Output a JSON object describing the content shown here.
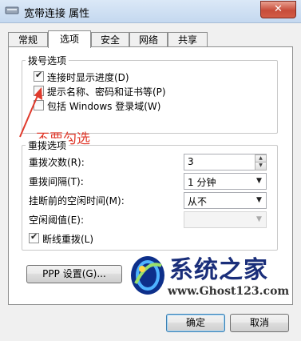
{
  "window": {
    "title": "宽带连接 属性",
    "close_symbol": "✕"
  },
  "tabs": [
    {
      "label": "常规",
      "active": false
    },
    {
      "label": "选项",
      "active": true
    },
    {
      "label": "安全",
      "active": false
    },
    {
      "label": "网络",
      "active": false
    },
    {
      "label": "共享",
      "active": false
    }
  ],
  "dial_options": {
    "title": "拨号选项",
    "items": [
      {
        "label": "连接时显示进度(D)",
        "checked": true
      },
      {
        "label": "提示名称、密码和证书等(P)",
        "checked": false
      },
      {
        "label": "包括 Windows 登录域(W)",
        "checked": false
      }
    ]
  },
  "annotation": {
    "text": "不要勾选",
    "color": "#e03a2c"
  },
  "redial_options": {
    "title": "重拨选项",
    "redial_count_label": "重拨次数(R):",
    "redial_count_value": "3",
    "redial_interval_label": "重拨间隔(T):",
    "redial_interval_value": "1 分钟",
    "idle_hangup_label": "挂断前的空闲时间(M):",
    "idle_hangup_value": "从不",
    "idle_threshold_label": "空闲阈值(E):",
    "idle_threshold_value": "",
    "reconnect_label": "断线重拨(L)",
    "reconnect_checked": true
  },
  "buttons": {
    "ppp_settings": "PPP 设置(G)...",
    "ok": "确定",
    "cancel": "取消"
  },
  "watermark": {
    "name": "系统之家",
    "url": "www.Ghost123.com"
  },
  "icons": {
    "title_icon": "network-connection-icon",
    "close": "close-icon",
    "check": "checkmark-icon",
    "spin_up": "spin-up-icon",
    "spin_down": "spin-down-icon",
    "dropdown": "chevron-down-icon"
  }
}
